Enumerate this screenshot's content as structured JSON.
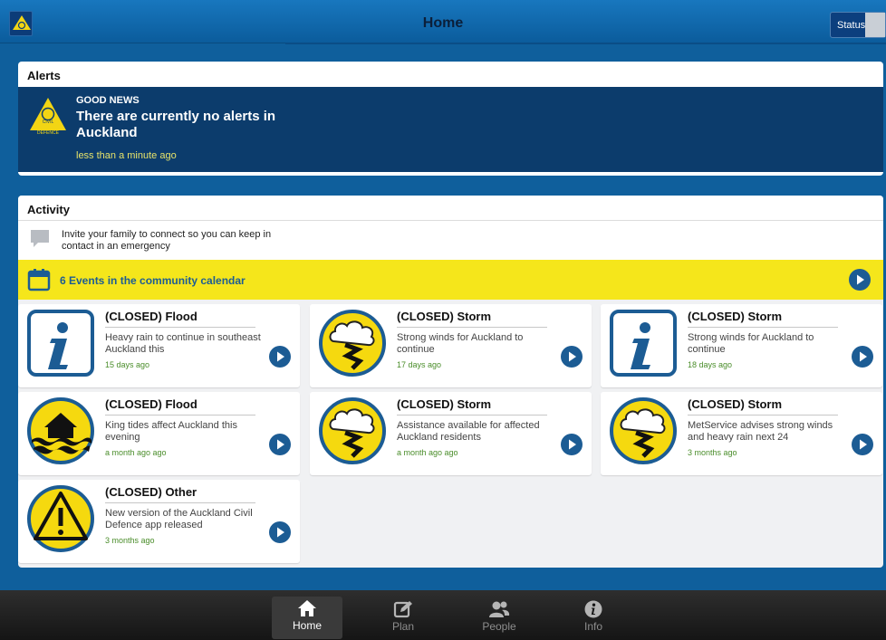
{
  "header": {
    "title": "Home",
    "status_label": "Status"
  },
  "alerts": {
    "title": "Alerts",
    "kicker": "GOOD NEWS",
    "message": "There are currently no alerts in Auckland",
    "time": "less than a minute ago",
    "logo_text": "CIVIL DEFENCE"
  },
  "activity": {
    "title": "Activity",
    "invite_text": "Invite your family to connect so you can keep in contact in an emergency",
    "calendar_text": "6 Events in the community calendar",
    "cards": [
      {
        "title": "(CLOSED) Flood",
        "desc": "Heavy rain to continue in southeast Auckland this",
        "time": "15 days ago",
        "icon": "info-icon"
      },
      {
        "title": "(CLOSED) Storm",
        "desc": "Strong winds for Auckland to continue",
        "time": "17 days ago",
        "icon": "storm-icon"
      },
      {
        "title": "(CLOSED) Storm",
        "desc": "Strong winds for Auckland to continue",
        "time": "18 days ago",
        "icon": "info-icon"
      },
      {
        "title": "(CLOSED) Flood",
        "desc": "King tides affect Auckland this evening",
        "time": "a month ago ago",
        "icon": "flood-icon"
      },
      {
        "title": "(CLOSED) Storm",
        "desc": "Assistance available for affected Auckland residents",
        "time": "a month ago ago",
        "icon": "storm-icon"
      },
      {
        "title": "(CLOSED) Storm",
        "desc": "MetService advises strong winds and heavy rain next 24",
        "time": "3 months ago",
        "icon": "storm-icon"
      },
      {
        "title": "(CLOSED) Other",
        "desc": "New version of the Auckland Civil Defence app released",
        "time": "3 months ago",
        "icon": "warning-icon"
      }
    ]
  },
  "tabs": [
    {
      "label": "Home",
      "icon": "house-icon",
      "active": true
    },
    {
      "label": "Plan",
      "icon": "edit-icon",
      "active": false
    },
    {
      "label": "People",
      "icon": "people-icon",
      "active": false
    },
    {
      "label": "Info",
      "icon": "info-circle-icon",
      "active": false
    }
  ],
  "colors": {
    "background": "#0f5f9c",
    "alert_box": "#0c3c6c",
    "calendar_bar": "#f5e61b",
    "time_green": "#4a8d2a",
    "accent_blue": "#1c5c94"
  }
}
